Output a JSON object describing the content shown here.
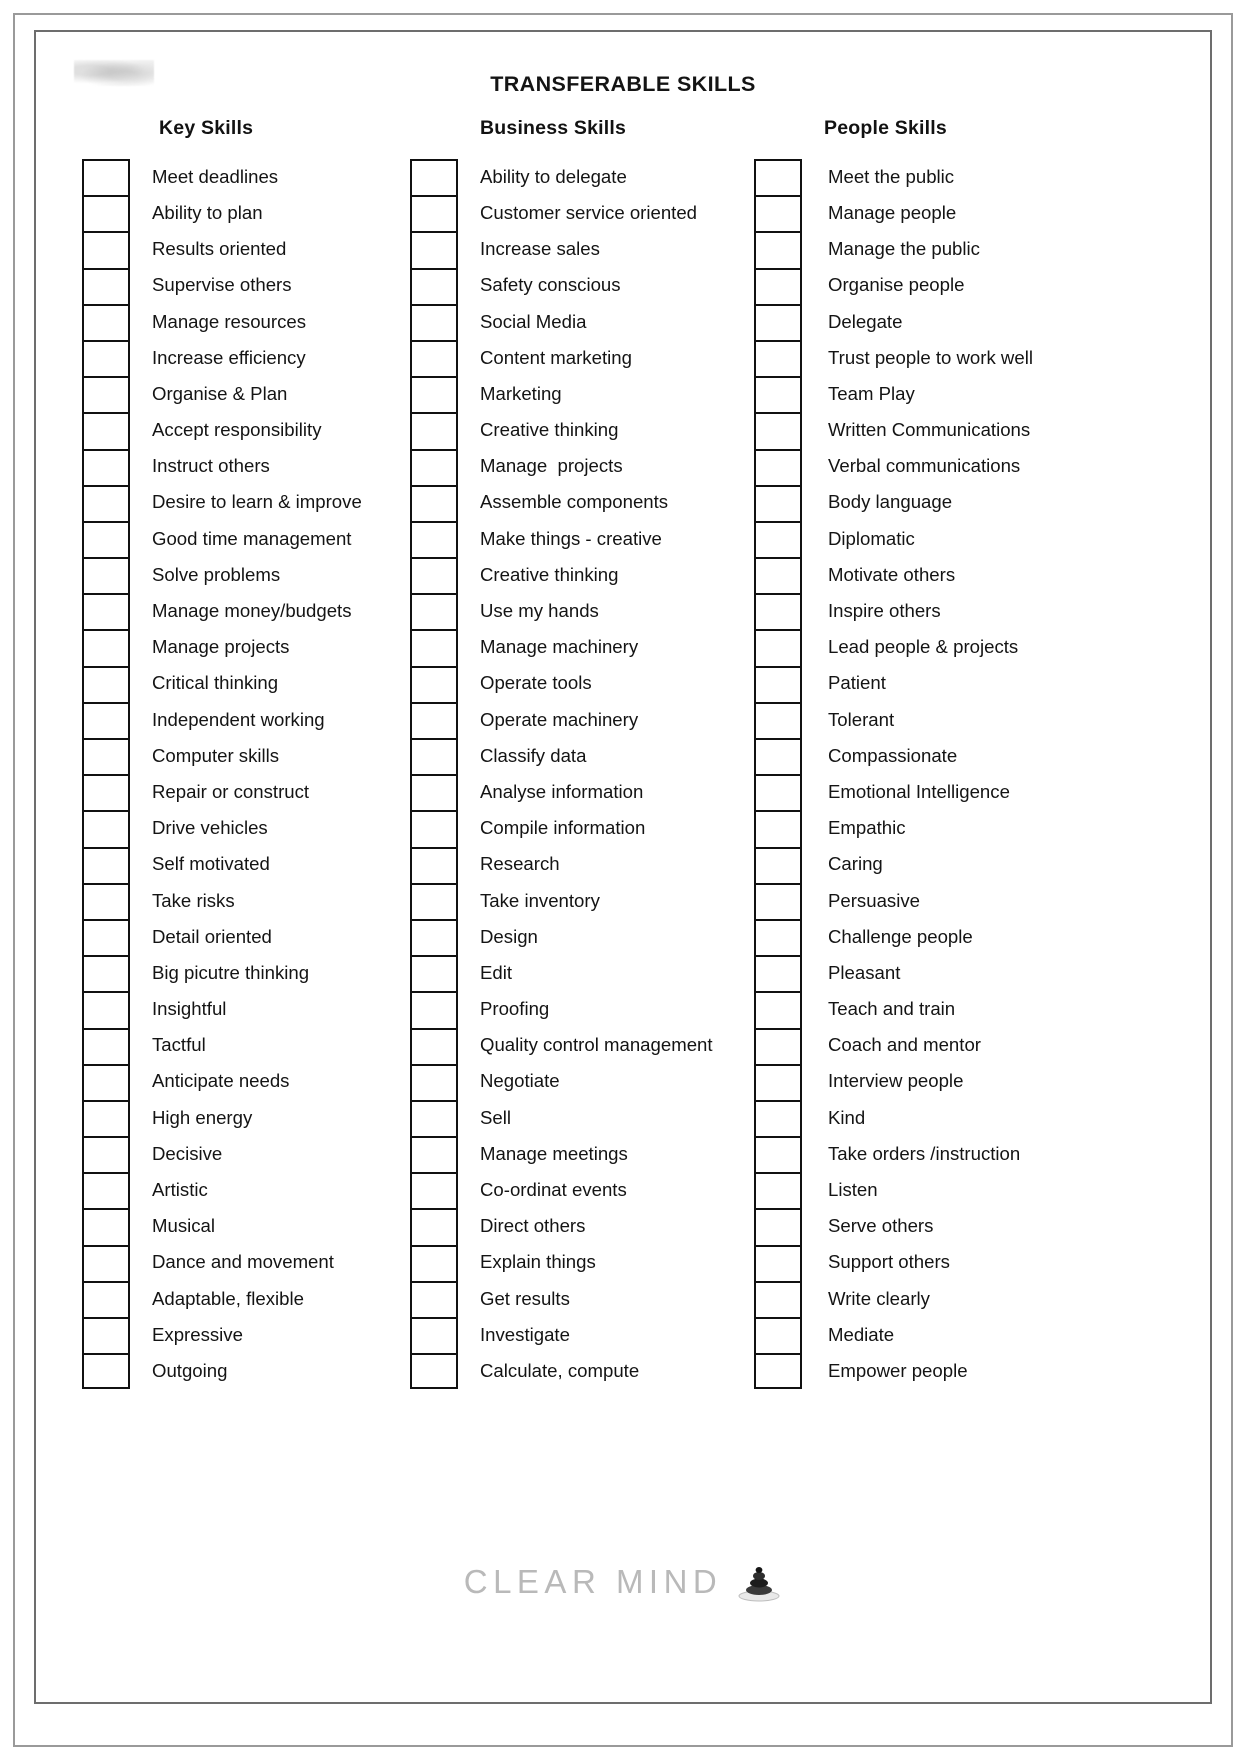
{
  "document": {
    "title": "TRANSFERABLE SKILLS"
  },
  "footer": {
    "logo_text": "CLEAR MIND",
    "logo_mark": "stone-stack-icon"
  },
  "columns": [
    {
      "heading": "Key Skills",
      "items": [
        "Meet deadlines",
        "Ability to plan",
        "Results oriented",
        "Supervise others",
        "Manage resources",
        "Increase efficiency",
        "Organise & Plan",
        "Accept responsibility",
        "Instruct others",
        "Desire to learn & improve",
        "Good time management",
        "Solve problems",
        "Manage money/budgets",
        "Manage projects",
        "Critical thinking",
        "Independent working",
        "Computer skills",
        "Repair or construct",
        "Drive vehicles",
        "Self motivated",
        "Take risks",
        "Detail oriented",
        "Big picutre thinking",
        "Insightful",
        "Tactful",
        "Anticipate needs",
        "High energy",
        "Decisive",
        "Artistic",
        "Musical",
        "Dance and movement",
        "Adaptable, flexible",
        "Expressive",
        "Outgoing"
      ]
    },
    {
      "heading": "Business Skills",
      "items": [
        "Ability to delegate",
        "Customer service oriented",
        "Increase sales",
        "Safety conscious",
        "Social Media",
        "Content marketing",
        "Marketing",
        "Creative thinking",
        "Manage  projects",
        "Assemble components",
        "Make things - creative",
        "Creative thinking",
        "Use my hands",
        "Manage machinery",
        "Operate tools",
        "Operate machinery",
        "Classify data",
        "Analyse information",
        "Compile information",
        "Research",
        "Take inventory",
        "Design",
        "Edit",
        "Proofing",
        "Quality control management",
        "Negotiate",
        "Sell",
        "Manage meetings",
        "Co-ordinat events",
        "Direct others",
        "Explain things",
        "Get results",
        "Investigate",
        "Calculate, compute"
      ]
    },
    {
      "heading": "People Skills",
      "items": [
        "Meet the public",
        "Manage people",
        "Manage the public",
        "Organise people",
        "Delegate",
        "Trust people to work well",
        "Team Play",
        "Written Communications",
        "Verbal communications",
        "Body language",
        "Diplomatic",
        "Motivate others",
        "Inspire others",
        "Lead people & projects",
        "Patient",
        "Tolerant",
        "Compassionate",
        "Emotional Intelligence",
        "Empathic",
        "Caring",
        "Persuasive",
        "Challenge people",
        "Pleasant",
        "Teach and train",
        "Coach and mentor",
        "Interview people",
        "Kind",
        "Take orders /instruction",
        "Listen",
        "Serve others",
        "Support others",
        "Write clearly",
        "Mediate",
        "Empower people"
      ]
    }
  ]
}
